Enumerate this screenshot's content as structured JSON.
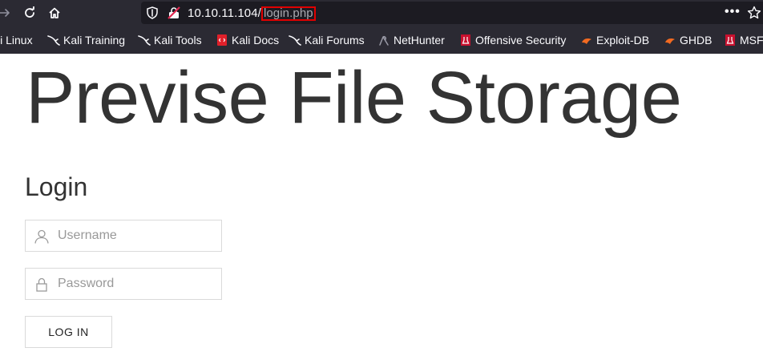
{
  "browser": {
    "url_host": "10.10.11.104/",
    "url_path": "login.php",
    "page_actions": "•••"
  },
  "bookmarks": [
    {
      "label": "li Linux",
      "icon": "kali-icon"
    },
    {
      "label": "Kali Training",
      "icon": "kali-icon"
    },
    {
      "label": "Kali Tools",
      "icon": "kali-icon"
    },
    {
      "label": "Kali Docs",
      "icon": "kali-docs-icon"
    },
    {
      "label": "Kali Forums",
      "icon": "kali-icon"
    },
    {
      "label": "NetHunter",
      "icon": "nethunter-icon"
    },
    {
      "label": "Offensive Security",
      "icon": "offsec-icon"
    },
    {
      "label": "Exploit-DB",
      "icon": "exploitdb-icon"
    },
    {
      "label": "GHDB",
      "icon": "exploitdb-icon"
    },
    {
      "label": "MSF",
      "icon": "offsec-icon"
    }
  ],
  "page": {
    "site_title": "Previse File Storage",
    "login_heading": "Login",
    "username_placeholder": "Username",
    "password_placeholder": "Password",
    "login_button": "LOG IN"
  }
}
